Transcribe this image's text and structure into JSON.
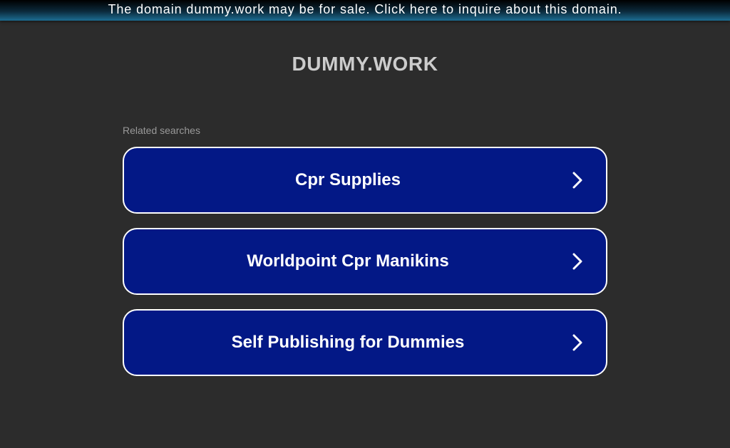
{
  "banner": {
    "text": "The domain dummy.work may be for sale. Click here to inquire about this domain."
  },
  "domain": {
    "title": "DUMMY.WORK"
  },
  "related": {
    "label": "Related searches",
    "items": [
      {
        "label": "Cpr Supplies",
        "icon": "chevron-right-icon"
      },
      {
        "label": "Worldpoint Cpr Manikins",
        "icon": "chevron-right-icon"
      },
      {
        "label": "Self Publishing for Dummies",
        "icon": "chevron-right-icon"
      }
    ]
  },
  "colors": {
    "background": "#2c2c2c",
    "button_background": "#031886",
    "button_border": "#ffffff",
    "title": "#cccccc",
    "label": "#999999"
  }
}
